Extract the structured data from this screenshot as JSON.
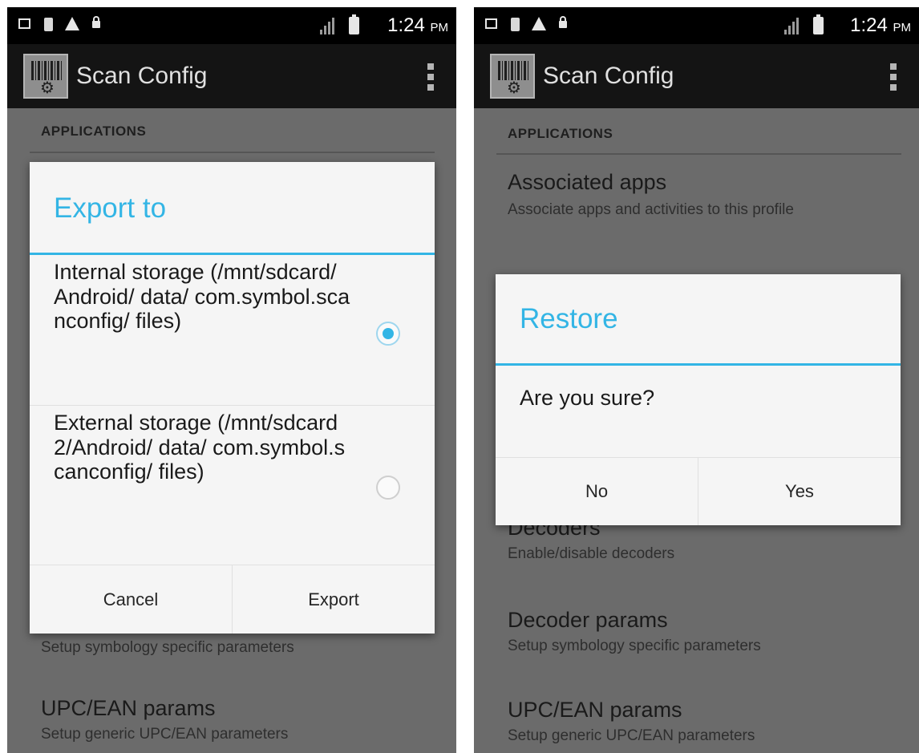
{
  "screens": [
    {
      "status_bar": {
        "time": "1:24",
        "ampm": "PM"
      },
      "action_bar": {
        "title": "Scan Config"
      },
      "section_header": "APPLICATIONS",
      "background_items": [
        {
          "title": "",
          "subtitle": "Setup symbology specific parameters"
        },
        {
          "title": "UPC/EAN params",
          "subtitle": "Setup generic UPC/EAN parameters"
        }
      ],
      "dialog": {
        "title": "Export to",
        "options": [
          {
            "label": "Internal storage (/mnt/sdcard/Android/ data/ com.symbol.scanconfig/ files)",
            "selected": true
          },
          {
            "label": "External storage (/mnt/sdcard2/Android/ data/ com.symbol.scanconfig/ files)",
            "selected": false
          }
        ],
        "buttons": {
          "cancel": "Cancel",
          "confirm": "Export"
        }
      }
    },
    {
      "status_bar": {
        "time": "1:24",
        "ampm": "PM"
      },
      "action_bar": {
        "title": "Scan Config"
      },
      "section_header": "APPLICATIONS",
      "background_items": [
        {
          "title": "Associated apps",
          "subtitle": "Associate apps and activities to this profile"
        },
        {
          "title": "Decoders",
          "subtitle": "Enable/disable decoders"
        },
        {
          "title": "Decoder params",
          "subtitle": "Setup symbology specific parameters"
        },
        {
          "title": "UPC/EAN params",
          "subtitle": "Setup generic UPC/EAN parameters"
        }
      ],
      "dialog": {
        "title": "Restore",
        "message": "Are you sure?",
        "buttons": {
          "cancel": "No",
          "confirm": "Yes"
        }
      }
    }
  ],
  "colors": {
    "accent": "#33b5e5",
    "dim_background": "#6b6b6b",
    "action_bar": "#141414"
  },
  "icons": [
    "screenshot-icon",
    "sim-card-icon",
    "warning-icon",
    "lock-icon",
    "no-sim-signal-icon",
    "battery-icon",
    "barcode-settings-icon",
    "overflow-menu-icon"
  ]
}
